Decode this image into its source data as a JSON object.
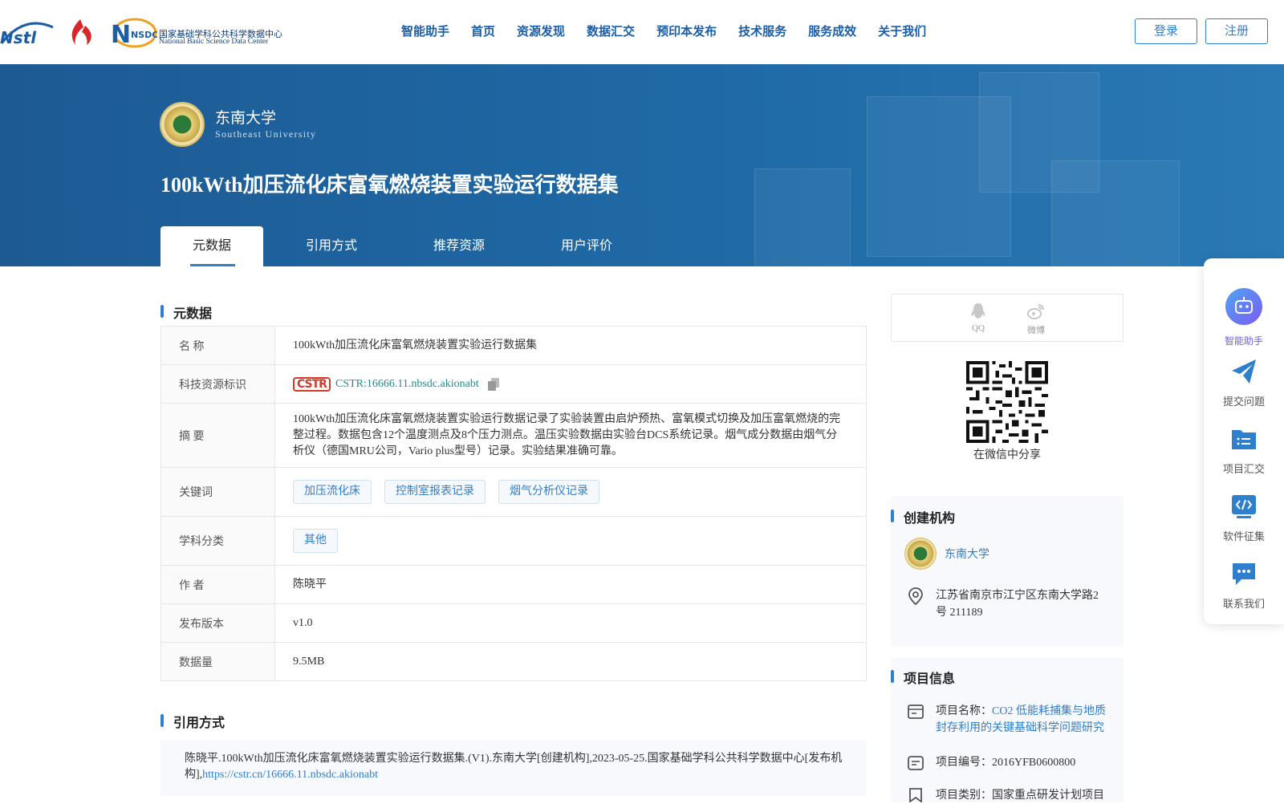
{
  "header": {
    "logos": [
      "Nstl",
      "NSDC",
      "国家基础学科公共科学数据中心",
      "National Basic Science Data Center"
    ],
    "nav": [
      "智能助手",
      "首页",
      "资源发现",
      "数据汇交",
      "预印本发布",
      "技术服务",
      "服务成效",
      "关于我们"
    ],
    "login": "登录",
    "register": "注册"
  },
  "banner": {
    "university_cn": "东南大学",
    "university_en": "Southeast University",
    "title": "100kWth加压流化床富氧燃烧装置实验运行数据集",
    "tabs": [
      "元数据",
      "引用方式",
      "推荐资源",
      "用户评价"
    ],
    "active_tab": "元数据"
  },
  "metadata": {
    "section_title": "元数据",
    "rows": {
      "name": {
        "label": "名 称",
        "value": "100kWth加压流化床富氧燃烧装置实验运行数据集"
      },
      "cstr": {
        "label": "科技资源标识",
        "logo": "CSTR",
        "value": "CSTR:16666.11.nbsdc.akionabt"
      },
      "abstract": {
        "label": "摘 要",
        "value": "100kWth加压流化床富氧燃烧装置实验运行数据记录了实验装置由启炉预热、富氧模式切换及加压富氧燃烧的完整过程。数据包含12个温度测点及8个压力测点。温压实验数据由实验台DCS系统记录。烟气成分数据由烟气分析仪（德国MRU公司，Vario plus型号）记录。实验结果准确可靠。"
      },
      "keywords": {
        "label": "关键词",
        "values": [
          "加压流化床",
          "控制室报表记录",
          "烟气分析仪记录"
        ]
      },
      "subject": {
        "label": "学科分类",
        "values": [
          "其他"
        ]
      },
      "author": {
        "label": "作 者",
        "value": "陈晓平"
      },
      "version": {
        "label": "发布版本",
        "value": "v1.0"
      },
      "size": {
        "label": "数据量",
        "value": "9.5MB"
      }
    }
  },
  "citation": {
    "section_title": "引用方式",
    "text": "陈晓平.100kWth加压流化床富氧燃烧装置实验运行数据集.(V1).东南大学[创建机构],2023-05-25.国家基础学科公共科学数据中心[发布机构],",
    "url": "https://cstr.cn/16666.11.nbsdc.akionabt"
  },
  "share": {
    "qq": "QQ",
    "weibo": "微博",
    "wechat_caption": "在微信中分享"
  },
  "org": {
    "section_title": "创建机构",
    "name": "东南大学",
    "address": "江苏省南京市江宁区东南大学路2号 211189"
  },
  "project": {
    "section_title": "项目信息",
    "name_label": "项目名称：",
    "name_value": "CO2 低能耗捕集与地质封存利用的关键基础科学问题研究",
    "number": "项目编号：2016YFB0600800",
    "category": "项目类别：国家重点研发计划项目"
  },
  "floatbar": [
    "智能助手",
    "提交问题",
    "项目汇交",
    "软件征集",
    "联系我们"
  ],
  "colors": {
    "brand_blue": "#2f7fcf",
    "banner": "#1f6aa6",
    "assistant": "#6c5ce7"
  }
}
